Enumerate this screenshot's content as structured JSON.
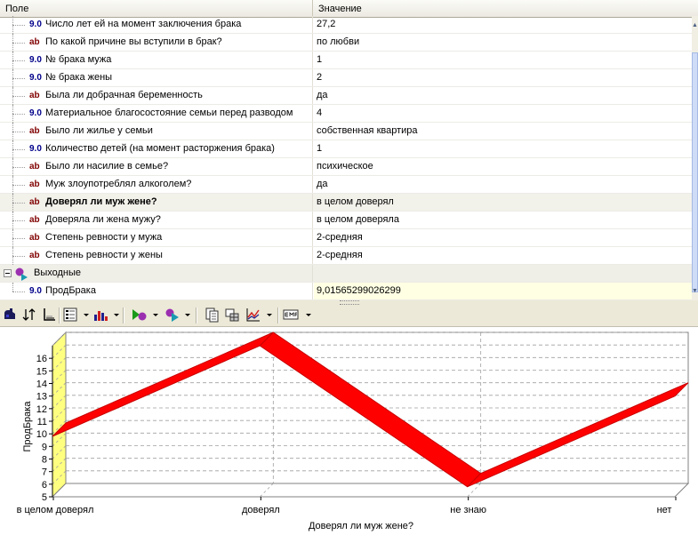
{
  "grid": {
    "columns": {
      "field": "Поле",
      "value": "Значение"
    },
    "rows": [
      {
        "type": "num",
        "badge": "9.0",
        "label": "Число лет ей на момент заключения брака",
        "value": "27,2"
      },
      {
        "type": "txt",
        "badge": "ab",
        "label": "По какой причине вы вступили в брак?",
        "value": "по любви"
      },
      {
        "type": "num",
        "badge": "9.0",
        "label": "№ брака мужа",
        "value": "1"
      },
      {
        "type": "num",
        "badge": "9.0",
        "label": "№ брака жены",
        "value": "2"
      },
      {
        "type": "txt",
        "badge": "ab",
        "label": "Была ли добрачная беременность",
        "value": "да"
      },
      {
        "type": "num",
        "badge": "9.0",
        "label": "Материальное благосостояние семьи перед разводом",
        "value": "4"
      },
      {
        "type": "txt",
        "badge": "ab",
        "label": "Было ли жилье у семьи",
        "value": "собственная квартира"
      },
      {
        "type": "num",
        "badge": "9.0",
        "label": "Количество детей (на момент расторжения брака)",
        "value": "1"
      },
      {
        "type": "txt",
        "badge": "ab",
        "label": "Было ли насилие в семье?",
        "value": "психическое"
      },
      {
        "type": "txt",
        "badge": "ab",
        "label": "Муж злоупотреблял алкоголем?",
        "value": "да"
      },
      {
        "type": "txt",
        "badge": "ab",
        "label": "Доверял ли муж жене?",
        "value": "в целом доверял",
        "bold": true
      },
      {
        "type": "txt",
        "badge": "ab",
        "label": "Доверяла ли жена мужу?",
        "value": "в целом доверяла"
      },
      {
        "type": "txt",
        "badge": "ab",
        "label": "Степень ревности у мужа",
        "value": "2-средняя"
      },
      {
        "type": "txt",
        "badge": "ab",
        "label": "Степень ревности у жены",
        "value": "2-средняя"
      }
    ],
    "group": {
      "label": "Выходные"
    },
    "output_row": {
      "type": "num",
      "badge": "9.0",
      "label": "ПродБрака",
      "value": "9,01565299026299"
    }
  },
  "toolbar": {
    "icons": [
      "palette-icon",
      "sort-icon",
      "axes-icon",
      "legend-icon",
      "bar-chart-icon",
      "input-field-icon",
      "output-field-icon",
      "copy-icon",
      "data-table-icon",
      "line-chart-icon",
      "export-emf-icon"
    ]
  },
  "colors": {
    "series": "#ff0000",
    "series_dark": "#c80000",
    "side_wall": "#ffff80",
    "grid": "#a0a0a0"
  },
  "chart_data": {
    "type": "line",
    "title": "",
    "xlabel": "Доверял ли муж жене?",
    "ylabel": "ПродБрака",
    "categories": [
      "в целом доверял",
      "доверял",
      "не знаю",
      "нет"
    ],
    "values": [
      9.8,
      17.0,
      5.8,
      13.0
    ],
    "ylim": [
      5,
      17
    ],
    "yticks": [
      "5",
      "6",
      "7",
      "8",
      "9",
      "10",
      "11",
      "12",
      "13",
      "14",
      "15",
      "16"
    ],
    "grid": true,
    "legend": "none"
  }
}
